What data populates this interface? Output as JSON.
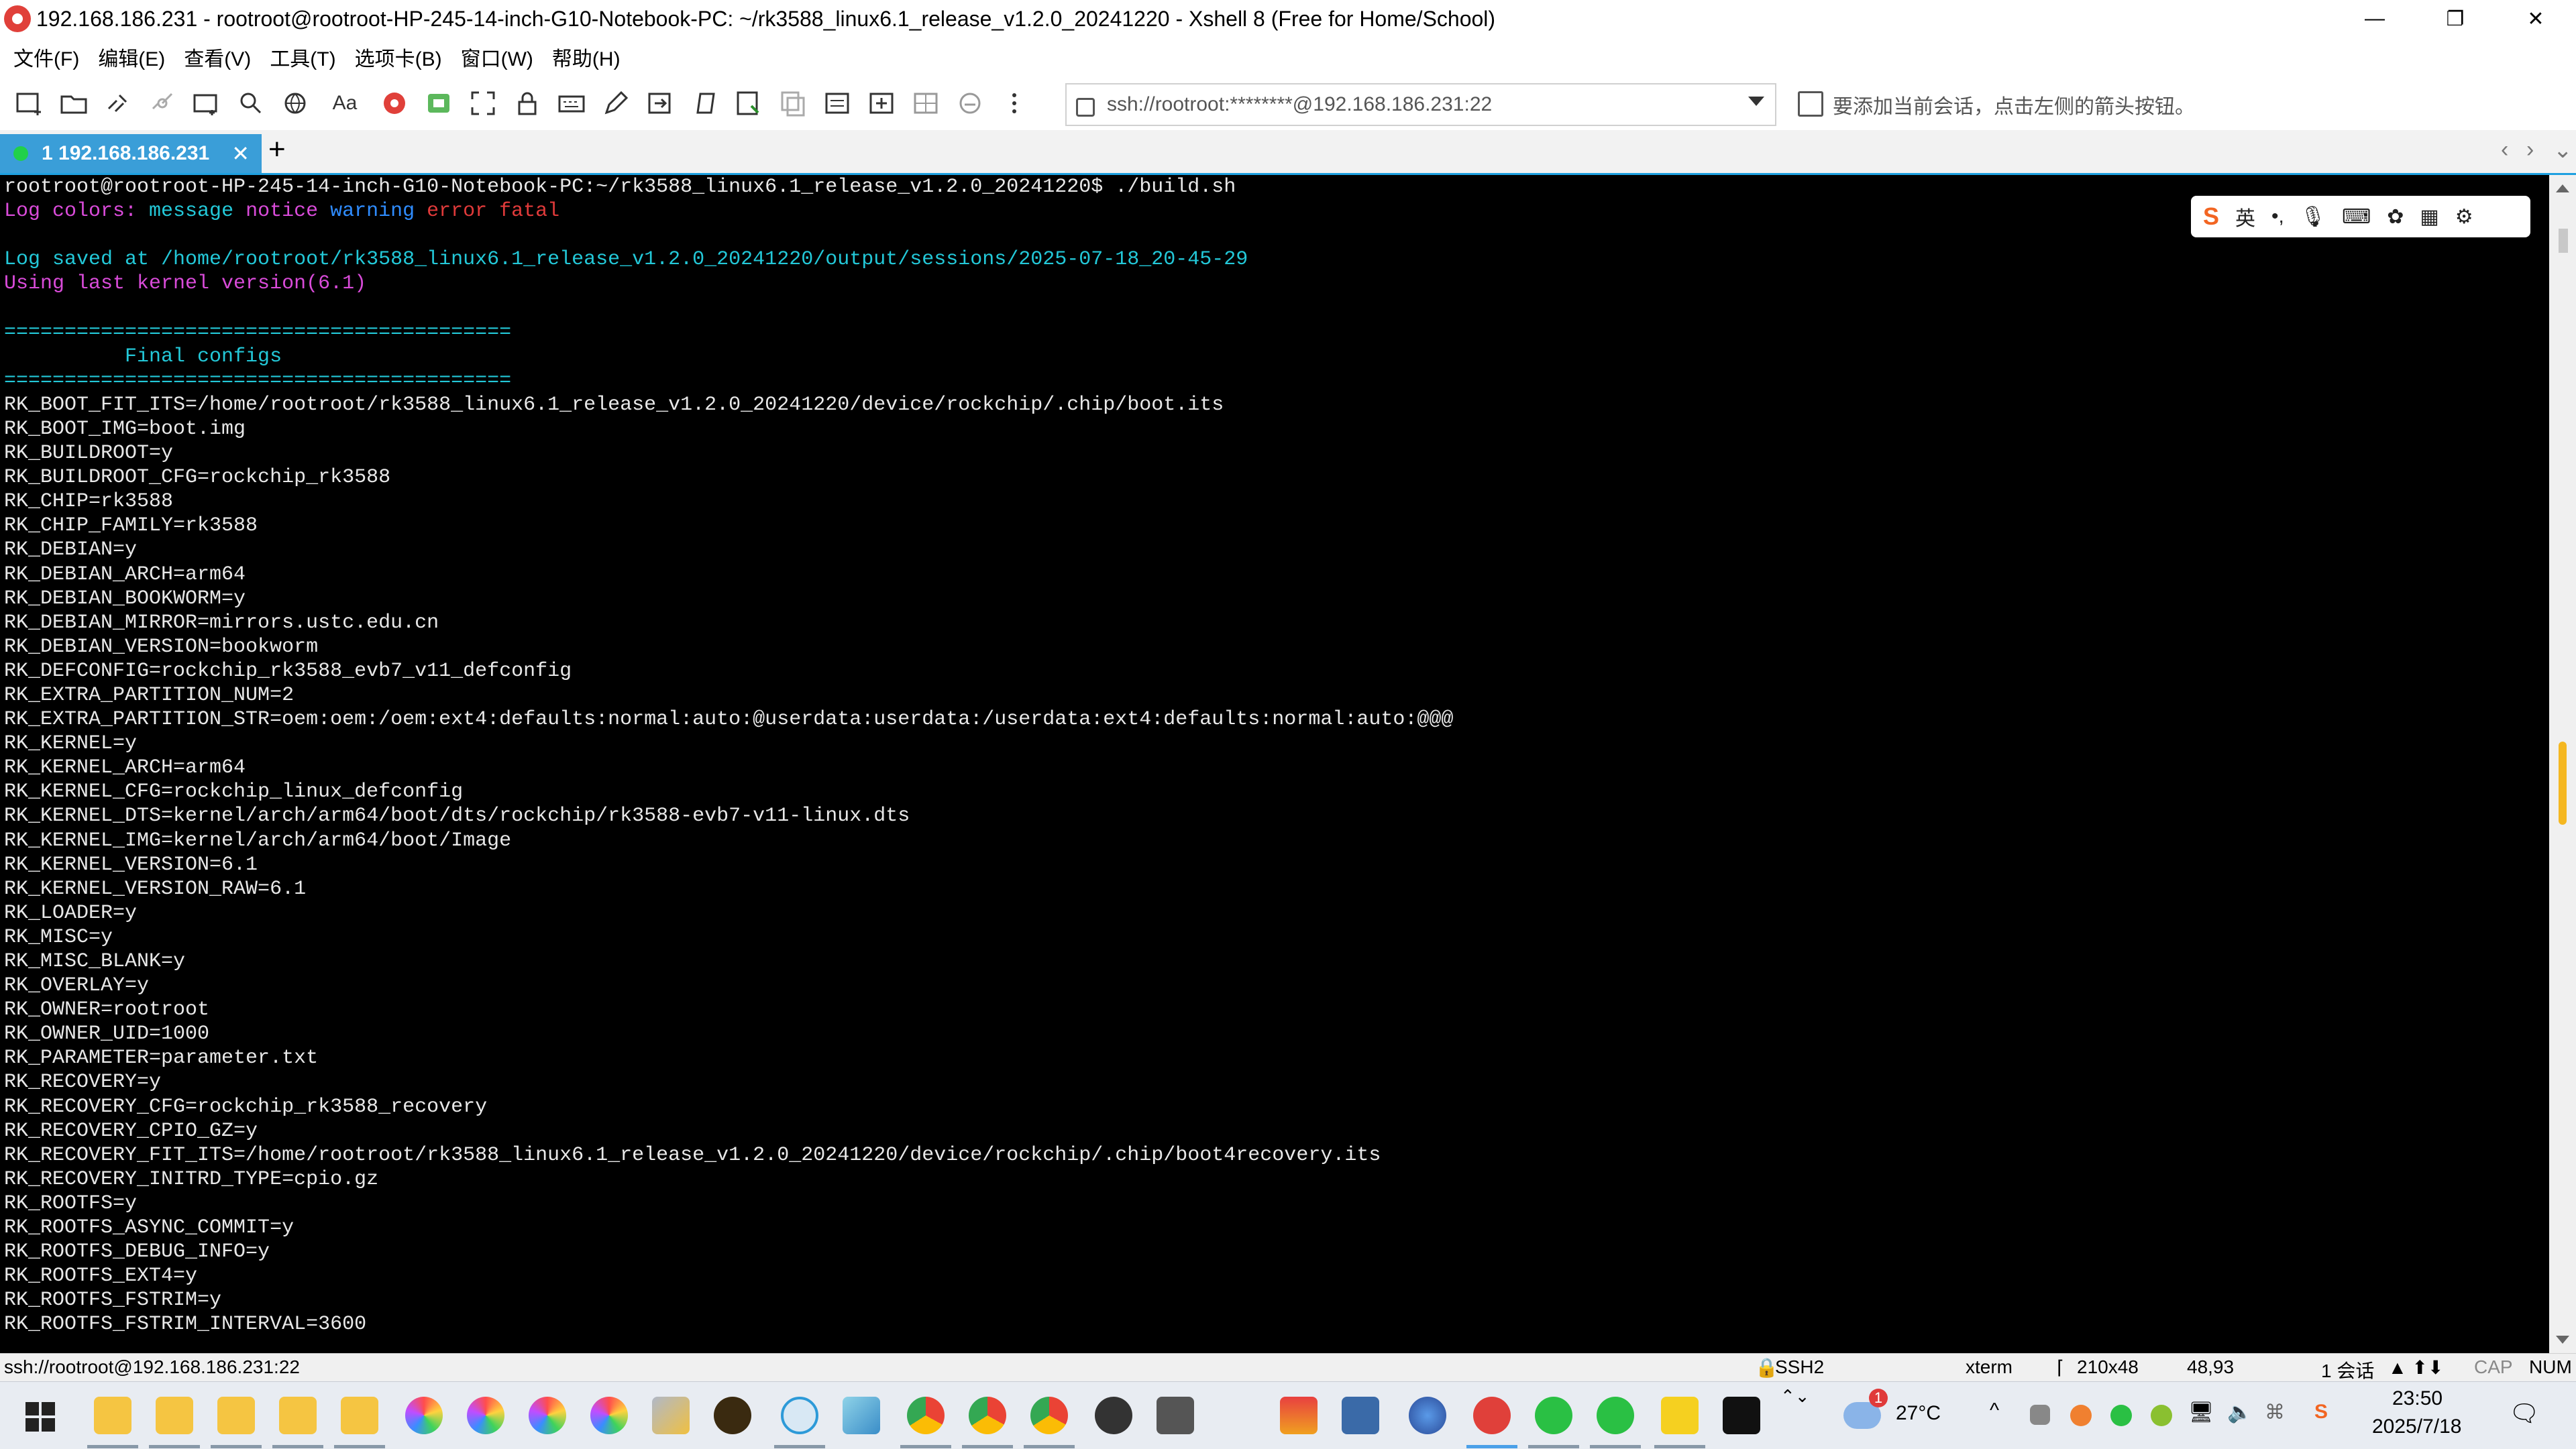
{
  "window": {
    "title": "192.168.186.231 - rootroot@rootroot-HP-245-14-inch-G10-Notebook-PC: ~/rk3588_linux6.1_release_v1.2.0_20241220 - Xshell 8 (Free for Home/School)",
    "minimize": "—",
    "maximize": "❐",
    "close": "✕"
  },
  "menu": [
    "文件(F)",
    "编辑(E)",
    "查看(V)",
    "工具(T)",
    "选项卡(B)",
    "窗口(W)",
    "帮助(H)"
  ],
  "toolbar": {
    "address": "ssh://rootroot:********@192.168.186.231:22",
    "hint": "要添加当前会话，点击左侧的箭头按钮。",
    "font_label": "Aa"
  },
  "tabs": [
    {
      "label": "1 192.168.186.231"
    }
  ],
  "tab_add": "+",
  "tab_nav": {
    "prev": "‹",
    "next": "›",
    "menu": "⌄"
  },
  "terminal": {
    "lines": [
      [
        {
          "t": "rootroot@rootroot-HP-245-14-inch-G10-Notebook-PC:~/rk3588_linux6.1_release_v1.2.0_20241220$ ./build.sh",
          "c": "white"
        }
      ],
      [
        {
          "t": "Log colors: ",
          "c": "magenta"
        },
        {
          "t": "message ",
          "c": "cyan"
        },
        {
          "t": "notice ",
          "c": "magenta"
        },
        {
          "t": "warning ",
          "c": "blue"
        },
        {
          "t": "error ",
          "c": "red"
        },
        {
          "t": "fatal",
          "c": "red"
        }
      ],
      [
        {
          "t": "",
          "c": "white"
        }
      ],
      [
        {
          "t": "Log saved at /home/rootroot/rk3588_linux6.1_release_v1.2.0_20241220/output/sessions/2025-07-18_20-45-29",
          "c": "cyan"
        }
      ],
      [
        {
          "t": "Using last kernel version(6.1)",
          "c": "magenta"
        }
      ],
      [
        {
          "t": "",
          "c": "white"
        }
      ],
      [
        {
          "t": "==========================================",
          "c": "cyan"
        }
      ],
      [
        {
          "t": "          Final configs",
          "c": "cyan"
        }
      ],
      [
        {
          "t": "==========================================",
          "c": "cyan"
        }
      ],
      [
        {
          "t": "RK_BOOT_FIT_ITS=/home/rootroot/rk3588_linux6.1_release_v1.2.0_20241220/device/rockchip/.chip/boot.its",
          "c": "white"
        }
      ],
      [
        {
          "t": "RK_BOOT_IMG=boot.img",
          "c": "white"
        }
      ],
      [
        {
          "t": "RK_BUILDROOT=y",
          "c": "white"
        }
      ],
      [
        {
          "t": "RK_BUILDROOT_CFG=rockchip_rk3588",
          "c": "white"
        }
      ],
      [
        {
          "t": "RK_CHIP=rk3588",
          "c": "white"
        }
      ],
      [
        {
          "t": "RK_CHIP_FAMILY=rk3588",
          "c": "white"
        }
      ],
      [
        {
          "t": "RK_DEBIAN=y",
          "c": "white"
        }
      ],
      [
        {
          "t": "RK_DEBIAN_ARCH=arm64",
          "c": "white"
        }
      ],
      [
        {
          "t": "RK_DEBIAN_BOOKWORM=y",
          "c": "white"
        }
      ],
      [
        {
          "t": "RK_DEBIAN_MIRROR=mirrors.ustc.edu.cn",
          "c": "white"
        }
      ],
      [
        {
          "t": "RK_DEBIAN_VERSION=bookworm",
          "c": "white"
        }
      ],
      [
        {
          "t": "RK_DEFCONFIG=rockchip_rk3588_evb7_v11_defconfig",
          "c": "white"
        }
      ],
      [
        {
          "t": "RK_EXTRA_PARTITION_NUM=2",
          "c": "white"
        }
      ],
      [
        {
          "t": "RK_EXTRA_PARTITION_STR=oem:oem:/oem:ext4:defaults:normal:auto:@userdata:userdata:/userdata:ext4:defaults:normal:auto:@@@",
          "c": "white"
        }
      ],
      [
        {
          "t": "RK_KERNEL=y",
          "c": "white"
        }
      ],
      [
        {
          "t": "RK_KERNEL_ARCH=arm64",
          "c": "white"
        }
      ],
      [
        {
          "t": "RK_KERNEL_CFG=rockchip_linux_defconfig",
          "c": "white"
        }
      ],
      [
        {
          "t": "RK_KERNEL_DTS=kernel/arch/arm64/boot/dts/rockchip/rk3588-evb7-v11-linux.dts",
          "c": "white"
        }
      ],
      [
        {
          "t": "RK_KERNEL_IMG=kernel/arch/arm64/boot/Image",
          "c": "white"
        }
      ],
      [
        {
          "t": "RK_KERNEL_VERSION=6.1",
          "c": "white"
        }
      ],
      [
        {
          "t": "RK_KERNEL_VERSION_RAW=6.1",
          "c": "white"
        }
      ],
      [
        {
          "t": "RK_LOADER=y",
          "c": "white"
        }
      ],
      [
        {
          "t": "RK_MISC=y",
          "c": "white"
        }
      ],
      [
        {
          "t": "RK_MISC_BLANK=y",
          "c": "white"
        }
      ],
      [
        {
          "t": "RK_OVERLAY=y",
          "c": "white"
        }
      ],
      [
        {
          "t": "RK_OWNER=rootroot",
          "c": "white"
        }
      ],
      [
        {
          "t": "RK_OWNER_UID=1000",
          "c": "white"
        }
      ],
      [
        {
          "t": "RK_PARAMETER=parameter.txt",
          "c": "white"
        }
      ],
      [
        {
          "t": "RK_RECOVERY=y",
          "c": "white"
        }
      ],
      [
        {
          "t": "RK_RECOVERY_CFG=rockchip_rk3588_recovery",
          "c": "white"
        }
      ],
      [
        {
          "t": "RK_RECOVERY_CPIO_GZ=y",
          "c": "white"
        }
      ],
      [
        {
          "t": "RK_RECOVERY_FIT_ITS=/home/rootroot/rk3588_linux6.1_release_v1.2.0_20241220/device/rockchip/.chip/boot4recovery.its",
          "c": "white"
        }
      ],
      [
        {
          "t": "RK_RECOVERY_INITRD_TYPE=cpio.gz",
          "c": "white"
        }
      ],
      [
        {
          "t": "RK_ROOTFS=y",
          "c": "white"
        }
      ],
      [
        {
          "t": "RK_ROOTFS_ASYNC_COMMIT=y",
          "c": "white"
        }
      ],
      [
        {
          "t": "RK_ROOTFS_DEBUG_INFO=y",
          "c": "white"
        }
      ],
      [
        {
          "t": "RK_ROOTFS_EXT4=y",
          "c": "white"
        }
      ],
      [
        {
          "t": "RK_ROOTFS_FSTRIM=y",
          "c": "white"
        }
      ],
      [
        {
          "t": "RK_ROOTFS_FSTRIM_INTERVAL=3600",
          "c": "white"
        }
      ]
    ]
  },
  "ime": {
    "lang": "英",
    "punct": "•,",
    "mic": "🎙",
    "keyboard": "⌨",
    "skin": "✿",
    "grid": "▦",
    "tools": "⚙"
  },
  "status": {
    "session": "ssh://rootroot@192.168.186.231:22",
    "protocol": "SSH2",
    "term": "xterm",
    "size": "210x48",
    "cursor": "48,93",
    "sessions": "1 会话",
    "cap": "CAP",
    "num": "NUM"
  },
  "taskbar": {
    "weather": "27°C",
    "time": "23:50",
    "date": "2025/7/18",
    "badge": "1"
  },
  "colors": {
    "white": "#e8e8e8",
    "cyan": "#23c8d8",
    "magenta": "#d94bd9",
    "blue": "#2f8cff",
    "red": "#e03a3a",
    "tab": "#3a9ed8",
    "accent": "#1ea0e0"
  }
}
